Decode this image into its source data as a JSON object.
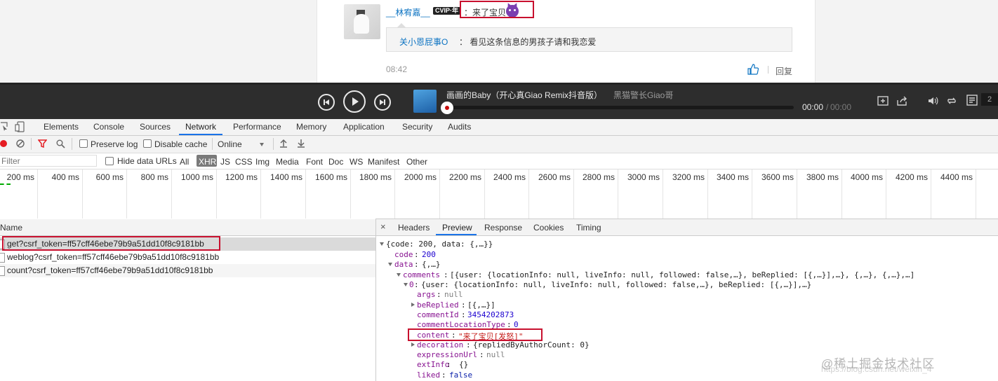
{
  "web": {
    "comment_user": "__林宥嘉__",
    "vip_badge": "CVIP·年",
    "comment_text": "：来了宝贝",
    "reply_user": "关小恩屁事O",
    "reply_text": "：  看见这条信息的男孩子请和我恋爱",
    "time": "08:42",
    "reply_link": "回复"
  },
  "player": {
    "song_title": "画画的Baby（开心真Giao Remix抖音版）",
    "artist": "黑猫警长Giao哥",
    "time_current": "00:00",
    "time_sep": "/",
    "time_total": "00:00",
    "playlist_count": "2",
    "progress": 0
  },
  "devtools": {
    "tabs": [
      "Elements",
      "Console",
      "Sources",
      "Network",
      "Performance",
      "Memory",
      "Application",
      "Security",
      "Audits"
    ],
    "active_tab": "Network",
    "toolbar": {
      "preserve_log": "Preserve log",
      "disable_cache": "Disable cache",
      "throttle": "Online"
    },
    "filter": {
      "placeholder": "Filter",
      "hide_data_urls": "Hide data URLs",
      "types": [
        "All",
        "XHR",
        "JS",
        "CSS",
        "Img",
        "Media",
        "Font",
        "Doc",
        "WS",
        "Manifest",
        "Other"
      ],
      "active_type": "XHR"
    },
    "timeline_ticks": [
      "200 ms",
      "400 ms",
      "600 ms",
      "800 ms",
      "1000 ms",
      "1200 ms",
      "1400 ms",
      "1600 ms",
      "1800 ms",
      "2000 ms",
      "2200 ms",
      "2400 ms",
      "2600 ms",
      "2800 ms",
      "3000 ms",
      "3200 ms",
      "3400 ms",
      "3600 ms",
      "3800 ms",
      "4000 ms",
      "4200 ms",
      "4400 ms",
      "46"
    ],
    "requests_header": "Name",
    "requests": [
      "get?csrf_token=ff57cff46ebe79b9a51dd10f8c9181bb",
      "weblog?csrf_token=ff57cff46ebe79b9a51dd10f8c9181bb",
      "count?csrf_token=ff57cff46ebe79b9a51dd10f8c9181bb"
    ],
    "detail_tabs": [
      "Headers",
      "Preview",
      "Response",
      "Cookies",
      "Timing"
    ],
    "active_detail_tab": "Preview",
    "preview": {
      "root": "{code: 200, data: {,…}}",
      "code_key": "code",
      "code_val": "200",
      "data_key": "data",
      "data_val": "{,…}",
      "comments_key": "comments",
      "comments_val": "[{user: {locationInfo: null, liveInfo: null, followed: false,…}, beReplied: [{,…}],…}, {,…}, {,…},…]",
      "item_key": "0",
      "item_val": "{user: {locationInfo: null, liveInfo: null, followed: false,…}, beReplied: [{,…}],…}",
      "args_key": "args",
      "args_val": "null",
      "bereplied_key": "beReplied",
      "bereplied_val": "[{,…}]",
      "commentid_key": "commentId",
      "commentid_val": "3454202873",
      "commentloc_key": "commentLocationType",
      "commentloc_val": "0",
      "content_key": "content",
      "content_val": "\"来了宝贝[发怒]\"",
      "decoration_key": "decoration",
      "decoration_val": "{repliedByAuthorCount: 0}",
      "expression_key": "expressionUrl",
      "expression_val": "null",
      "extinfo_key": "extInfo",
      "extinfo_val": "{}",
      "liked_key": "liked",
      "liked_val": "false"
    }
  },
  "watermark": "@稀土掘金技术社区",
  "watermark_url": "https://blog.csdn.net/weixin_4",
  "colors": {
    "accent": "#1a73e8",
    "highlight_border": "#c8102e",
    "player_bg": "#2d2d2d"
  }
}
